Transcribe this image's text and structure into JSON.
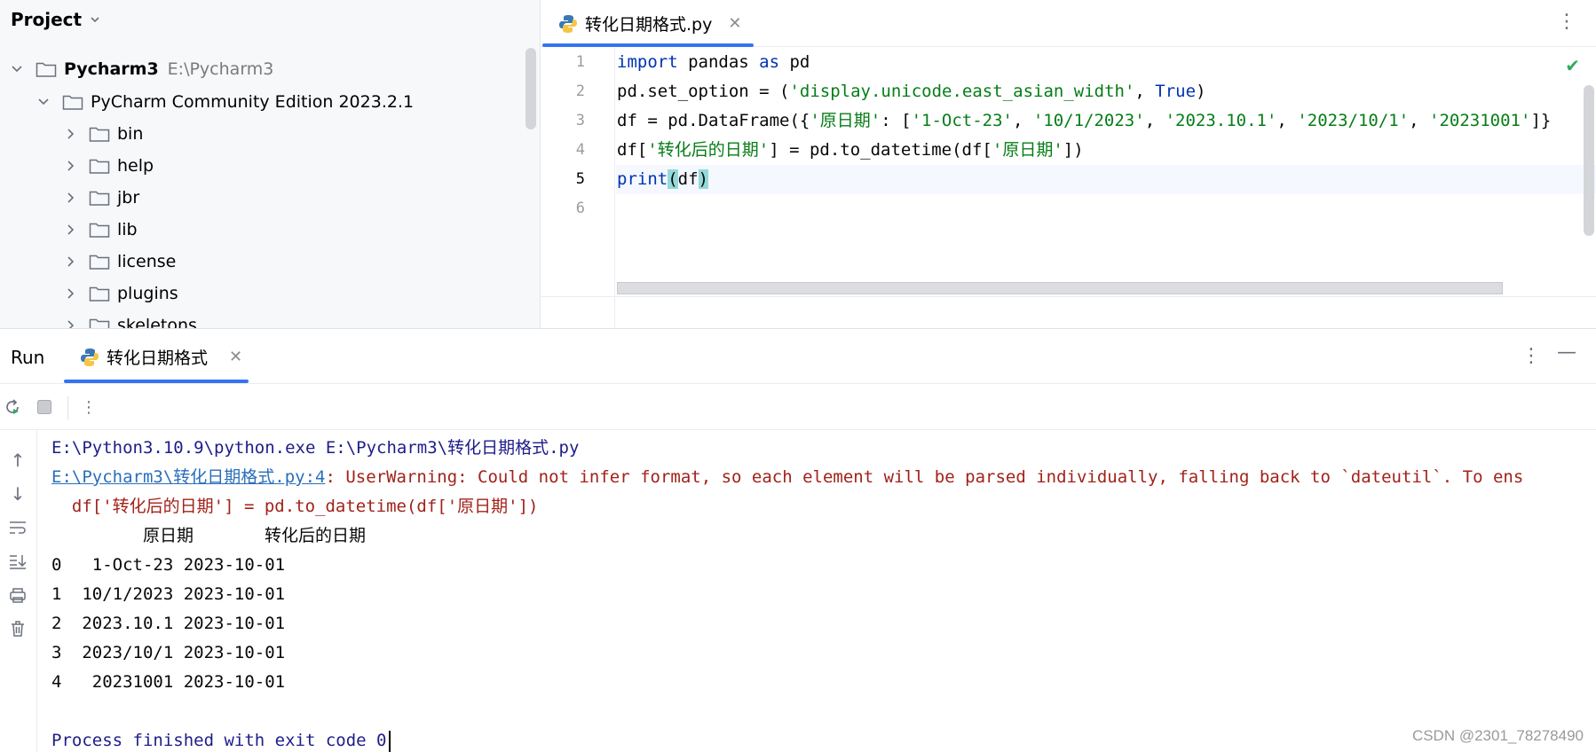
{
  "project": {
    "header": "Project",
    "root": {
      "name": "Pycharm3",
      "path": "E:\\Pycharm3"
    },
    "subroot": "PyCharm Community Edition 2023.2.1",
    "folders": [
      "bin",
      "help",
      "jbr",
      "lib",
      "license",
      "plugins",
      "skeletons"
    ]
  },
  "editor": {
    "tab_label": "转化日期格式.py",
    "line_numbers": [
      "1",
      "2",
      "3",
      "4",
      "5",
      "6"
    ],
    "code": {
      "l1": {
        "kw1": "import",
        "mid": " pandas ",
        "kw2": "as",
        "end": " pd"
      },
      "l2": {
        "a": "pd.set_option = (",
        "s": "'display.unicode.east_asian_width'",
        "b": ", ",
        "t": "True",
        "c": ")"
      },
      "l3": {
        "a": "df = pd.DataFrame({",
        "s1": "'原日期'",
        "b": ": [",
        "s2": "'1-Oct-23'",
        "c1": ", ",
        "s3": "'10/1/2023'",
        "c2": ", ",
        "s4": "'2023.10.1'",
        "c3": ", ",
        "s5": "'2023/10/1'",
        "c4": ", ",
        "s6": "'20231001'",
        "d": "]}"
      },
      "l4": {
        "a": "df[",
        "s1": "'转化后的日期'",
        "b": "] = pd.to_datetime(df[",
        "s2": "'原日期'",
        "c": "])"
      },
      "l5": {
        "fn": "print",
        "p1": "(",
        "arg": "df",
        "p2": ")"
      }
    }
  },
  "run": {
    "title": "Run",
    "tab_label": "转化日期格式",
    "output": {
      "cmd": "E:\\Python3.10.9\\python.exe E:\\Pycharm3\\转化日期格式.py",
      "warn_link": "E:\\Pycharm3\\转化日期格式.py:4",
      "warn_text": ": UserWarning: Could not infer format, so each element will be parsed individually, falling back to `dateutil`. To ens",
      "warn_code": "  df['转化后的日期'] = pd.to_datetime(df['原日期'])",
      "table_header": "         原日期       转化后的日期",
      "rows": [
        "0   1-Oct-23 2023-10-01",
        "1  10/1/2023 2023-10-01",
        "2  2023.10.1 2023-10-01",
        "3  2023/10/1 2023-10-01",
        "4   20231001 2023-10-01"
      ],
      "exit": "Process finished with exit code 0"
    }
  },
  "watermark": "CSDN @2301_78278490",
  "colors": {
    "accent": "#3574f0",
    "keyword": "#0033b3",
    "string": "#067d17",
    "error": "#a1221a"
  }
}
